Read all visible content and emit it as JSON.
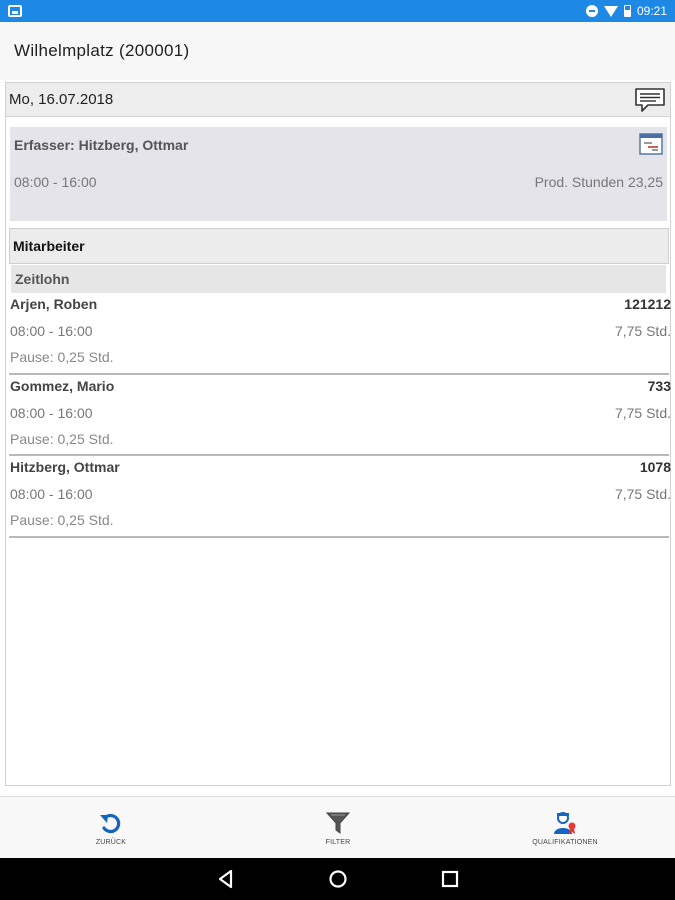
{
  "status_bar": {
    "time": "09:21",
    "icons": [
      "notification-icon",
      "do-not-disturb-icon",
      "wifi-icon",
      "battery-icon"
    ],
    "color": "#1e88e5"
  },
  "app_bar": {
    "title": "Wilhelmplatz  (200001)"
  },
  "day": {
    "date": "Mo, 16.07.2018",
    "comment_icon": "comment-icon"
  },
  "header_card": {
    "erfasser": "Erfasser: Hitzberg, Ottmar",
    "time": "08:00 - 16:00",
    "prod_hours": "Prod. Stunden 23,25",
    "calendar_icon": "calendar-icon"
  },
  "section": {
    "title": "Mitarbeiter"
  },
  "group": {
    "title": "Zeitlohn"
  },
  "employees": [
    {
      "name": "Arjen, Roben",
      "number": "121212",
      "time": "08:00 - 16:00",
      "hours": "7,75 Std.",
      "pause": "Pause: 0,25 Std."
    },
    {
      "name": "Gommez, Mario",
      "number": "733",
      "time": "08:00 - 16:00",
      "hours": "7,75 Std.",
      "pause": "Pause: 0,25 Std."
    },
    {
      "name": "Hitzberg, Ottmar",
      "number": "1078",
      "time": "08:00 - 16:00",
      "hours": "7,75 Std.",
      "pause": "Pause: 0,25 Std."
    }
  ],
  "toolbar": {
    "back_label": "ZURÜCK",
    "filter_label": "FILTER",
    "qualifications_label": "QUALIFIKATIONEN",
    "accent": "#1565c0"
  },
  "nav_bar": {
    "buttons": [
      "back-icon",
      "home-icon",
      "recents-icon"
    ]
  }
}
